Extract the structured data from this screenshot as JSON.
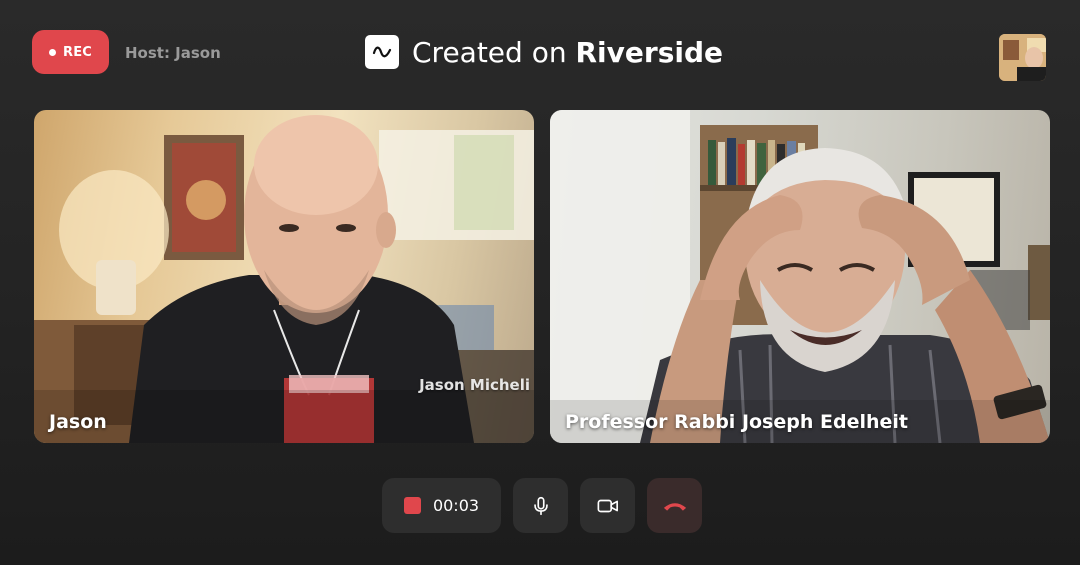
{
  "header": {
    "rec_label": "REC",
    "host_label": "Host: Jason",
    "brand_prefix": "Created on",
    "brand_name": "Riverside",
    "rec_color": "#e0474c"
  },
  "participants": [
    {
      "name": "Jason",
      "watermark": "Jason Micheli"
    },
    {
      "name": "Professor Rabbi Joseph Edelheit"
    }
  ],
  "controls": {
    "timer": "00:03",
    "record_icon": "stop-square-icon",
    "mic_icon": "microphone-icon",
    "camera_icon": "video-camera-icon",
    "leave_icon": "hang-up-phone-icon",
    "leave_color": "#e0474c"
  }
}
